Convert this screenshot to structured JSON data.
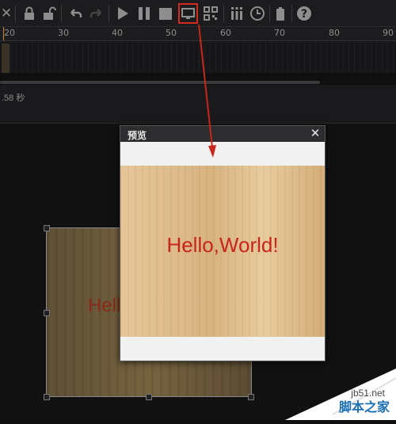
{
  "toolbar": {
    "icons": [
      "close-icon",
      "lock-icon",
      "unlock-icon",
      "undo-icon",
      "redo-icon",
      "play-icon",
      "pause-icon",
      "stop-icon",
      "preview-icon",
      "qr-code-icon",
      "equalizer-icon",
      "clock-icon",
      "battery-icon",
      "help-icon"
    ]
  },
  "ruler": {
    "ticks": [
      "20",
      "30",
      "40",
      "50",
      "60",
      "70",
      "80",
      "90"
    ]
  },
  "time": {
    "value": ".58 秒"
  },
  "preview_dialog": {
    "title": "预览",
    "close_glyph": "✕",
    "text": "Hello,World!"
  },
  "canvas_text": "Hello",
  "watermark": {
    "url": "jb51.net",
    "name": "脚本之家"
  },
  "colors": {
    "accent": "#d42b1e",
    "text_red": "#c8261a"
  }
}
